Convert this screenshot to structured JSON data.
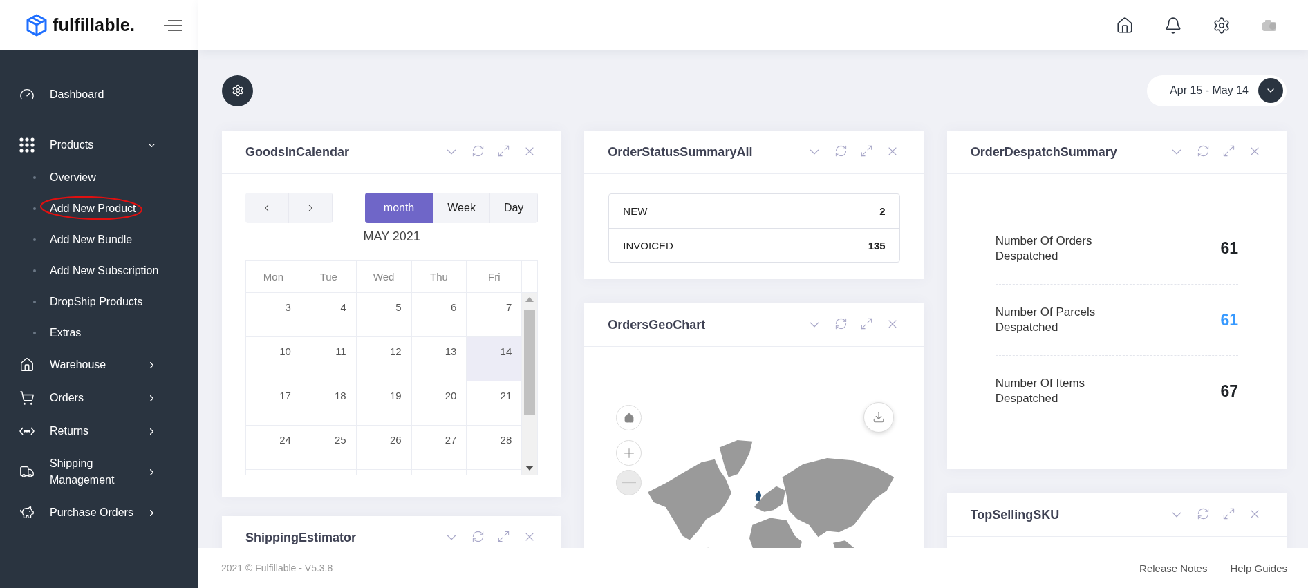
{
  "brand": {
    "name": "fulfillable."
  },
  "sidebar": {
    "items": [
      {
        "label": "Dashboard",
        "kind": "link"
      },
      {
        "label": "Products",
        "kind": "group",
        "expanded": true,
        "children": [
          {
            "label": "Overview",
            "circled": false
          },
          {
            "label": "Add New Product",
            "circled": true
          },
          {
            "label": "Add New Bundle",
            "circled": false
          },
          {
            "label": "Add New Subscription",
            "circled": false
          },
          {
            "label": "DropShip Products",
            "circled": false
          },
          {
            "label": "Extras",
            "circled": false
          }
        ]
      },
      {
        "label": "Warehouse",
        "kind": "group",
        "expanded": false
      },
      {
        "label": "Orders",
        "kind": "group",
        "expanded": false
      },
      {
        "label": "Returns",
        "kind": "group",
        "expanded": false
      },
      {
        "label": "Shipping Management",
        "kind": "group",
        "expanded": false
      },
      {
        "label": "Purchase Orders",
        "kind": "group",
        "expanded": false
      }
    ]
  },
  "date_range": {
    "label": "Apr 15 - May 14"
  },
  "columns": [
    [
      {
        "kind": "calendar",
        "title": "GoodsInCalendar",
        "views": [
          {
            "label": "month",
            "selected": true
          },
          {
            "label": "Week",
            "selected": false
          },
          {
            "label": "Day",
            "selected": false
          }
        ],
        "month_title": "MAY 2021",
        "weekdays": [
          "Mon",
          "Tue",
          "Wed",
          "Thu",
          "Fri"
        ],
        "weeks": [
          [
            {
              "day": "3",
              "today": false
            },
            {
              "day": "4",
              "today": false
            },
            {
              "day": "5",
              "today": false
            },
            {
              "day": "6",
              "today": false
            },
            {
              "day": "7",
              "today": false
            }
          ],
          [
            {
              "day": "10",
              "today": false
            },
            {
              "day": "11",
              "today": false
            },
            {
              "day": "12",
              "today": false
            },
            {
              "day": "13",
              "today": false
            },
            {
              "day": "14",
              "today": true
            }
          ],
          [
            {
              "day": "17",
              "today": false
            },
            {
              "day": "18",
              "today": false
            },
            {
              "day": "19",
              "today": false
            },
            {
              "day": "20",
              "today": false
            },
            {
              "day": "21",
              "today": false
            }
          ],
          [
            {
              "day": "24",
              "today": false
            },
            {
              "day": "25",
              "today": false
            },
            {
              "day": "26",
              "today": false
            },
            {
              "day": "27",
              "today": false
            },
            {
              "day": "28",
              "today": false
            }
          ]
        ]
      },
      {
        "kind": "empty",
        "title": "ShippingEstimator"
      }
    ],
    [
      {
        "kind": "status_table",
        "title": "OrderStatusSummaryAll",
        "rows": [
          {
            "status": "NEW",
            "count": "2"
          },
          {
            "status": "INVOICED",
            "count": "135"
          }
        ]
      },
      {
        "kind": "geo_map",
        "title": "OrdersGeoChart"
      }
    ],
    [
      {
        "kind": "despatch_summary",
        "title": "OrderDespatchSummary",
        "stats": [
          {
            "label": "Number Of Orders Despatched",
            "value": "61",
            "color": "#212529"
          },
          {
            "label": "Number Of Parcels Despatched",
            "value": "61",
            "color": "#3699ff"
          },
          {
            "label": "Number Of Items Despatched",
            "value": "67",
            "color": "#212529"
          }
        ]
      },
      {
        "kind": "empty",
        "title": "TopSellingSKU"
      }
    ]
  ],
  "footer": {
    "copyright": "2021 © Fulfillable - V5.3.8",
    "links": [
      "Release Notes",
      "Help Guides"
    ]
  }
}
